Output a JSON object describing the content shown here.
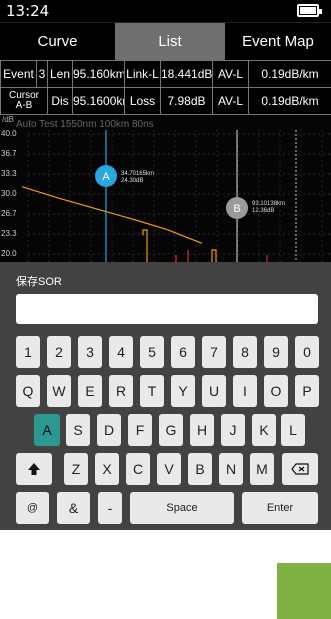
{
  "status": {
    "time": "13:24",
    "battery_icon": "battery-full-icon"
  },
  "tabs": [
    {
      "label": "Curve"
    },
    {
      "label": "List"
    },
    {
      "label": "Event Map"
    }
  ],
  "info": {
    "row1": {
      "event_label": "Event",
      "event_val": "3",
      "len_label": "Len",
      "len_val": "95.160km",
      "linkl_label": "Link-L",
      "linkl_val": "18.441dB",
      "avl_label": "AV-L",
      "avl_val": "0.19dB/km"
    },
    "row2": {
      "cursor_label_1": "Cursor",
      "cursor_label_2": "A-B",
      "dis_label": "Dis",
      "dis_val": "95.1600km",
      "loss_label": "Loss",
      "loss_val": "7.98dB",
      "avl_label": "AV-L",
      "avl_val": "0.19dB/km"
    }
  },
  "chart": {
    "unit": "/dB",
    "desc": "Auto Test   1550nm  100km  80ns",
    "yticks": [
      "40.0",
      "36.7",
      "33.3",
      "30.0",
      "26.7",
      "23.3",
      "20.0"
    ],
    "marker_a": {
      "label": "A",
      "line1": "34.70165km",
      "line2": "24.30dB"
    },
    "marker_b": {
      "label": "B",
      "line1": "93.10138km",
      "line2": "12.36dB"
    }
  },
  "chart_data": {
    "type": "line",
    "title": "",
    "xlabel": "",
    "ylabel": "/dB",
    "ylim": [
      16.7,
      40.0
    ],
    "series": [
      {
        "x": [
          0,
          36,
          72,
          108,
          144,
          180
        ],
        "y": [
          30.0,
          28.0,
          26.2,
          24.4,
          22.5,
          20.0
        ]
      }
    ],
    "cursors": [
      {
        "name": "A",
        "distance_km": 34.70165,
        "level_db": 24.3
      },
      {
        "name": "B",
        "distance_km": 93.10138,
        "level_db": 12.36
      }
    ],
    "grid": true
  },
  "keyboard": {
    "title": "保存SOR",
    "input_value": "",
    "row1": [
      "1",
      "2",
      "3",
      "4",
      "5",
      "6",
      "7",
      "8",
      "9",
      "0"
    ],
    "row2": [
      "Q",
      "W",
      "E",
      "R",
      "T",
      "Y",
      "U",
      "I",
      "O",
      "P"
    ],
    "row3": [
      "A",
      "S",
      "D",
      "F",
      "G",
      "H",
      "J",
      "K",
      "L"
    ],
    "row4": [
      "Z",
      "X",
      "C",
      "V",
      "B",
      "N",
      "M"
    ],
    "row5": {
      "at": "@",
      "amp": "&",
      "dash": "-",
      "space": "Space",
      "enter": "Enter"
    },
    "shift_icon": "shift-arrow-icon",
    "backspace_icon": "backspace-icon",
    "selected_key": "A"
  },
  "colors": {
    "accent": "#2b9990",
    "marker_a": "#2aa7e0",
    "marker_b": "#9a9a9a",
    "trace": "#f0a000",
    "tile": "#7fb241"
  }
}
